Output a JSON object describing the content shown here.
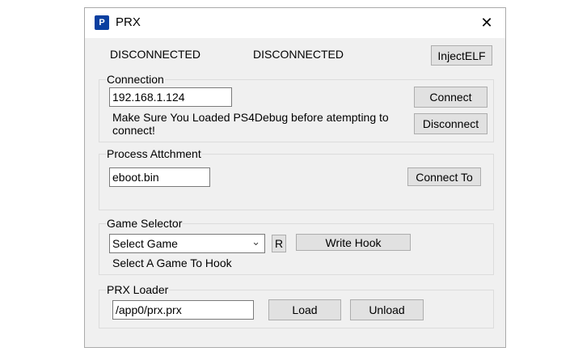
{
  "window": {
    "title": "PRX",
    "close_glyph": "✕",
    "app_icon": "playstation-logo-icon"
  },
  "status": {
    "left": "DISCONNECTED",
    "right": "DISCONNECTED"
  },
  "toolbar": {
    "inject_elf_label": "InjectELF"
  },
  "connection": {
    "legend": "Connection",
    "ip_value": "192.168.1.124",
    "hint": "Make Sure You Loaded PS4Debug before atempting to connect!",
    "connect_label": "Connect",
    "disconnect_label": "Disconnect"
  },
  "process": {
    "legend": "Process Attchment",
    "process_value": "eboot.bin",
    "connect_to_label": "Connect To"
  },
  "game": {
    "legend": "Game Selector",
    "selected": "Select Game",
    "refresh_label": "R",
    "write_hook_label": "Write Hook",
    "hint": "Select A Game To Hook"
  },
  "prx": {
    "legend": "PRX Loader",
    "path_value": "/app0/prx.prx",
    "load_label": "Load",
    "unload_label": "Unload"
  }
}
